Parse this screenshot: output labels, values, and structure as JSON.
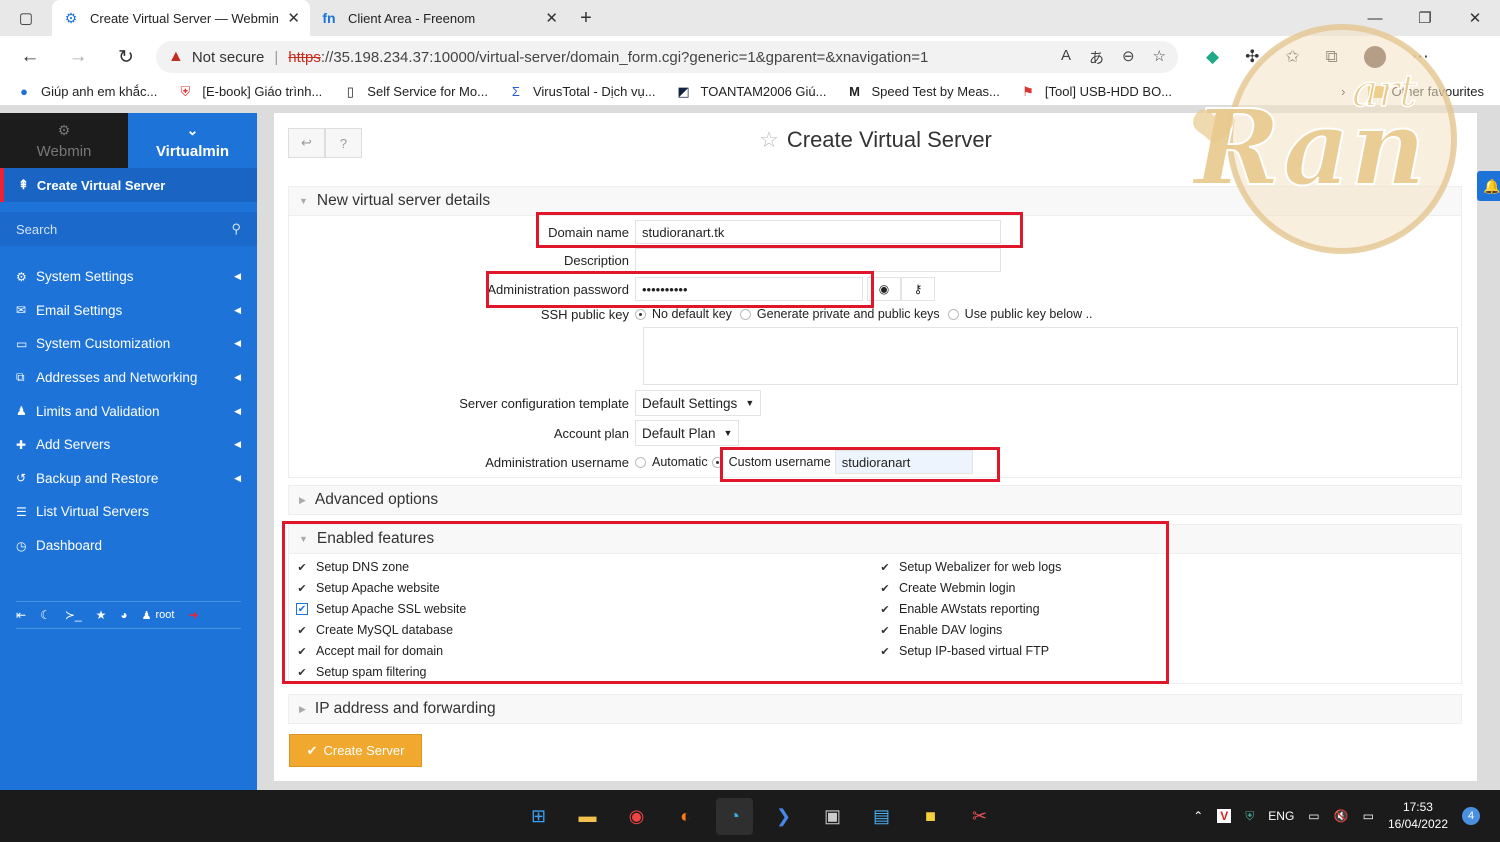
{
  "browser": {
    "tabs": [
      {
        "title": "Create Virtual Server — Webmin",
        "active": true
      },
      {
        "title": "Client Area - Freenom",
        "active": false
      }
    ],
    "address": {
      "security": "Not secure",
      "scheme": "https",
      "url_rest": "://35.198.234.37:10000/virtual-server/domain_form.cgi?generic=1&gparent=&xnavigation=1"
    },
    "bookmarks": [
      "Giúp anh em khắc...",
      "[E-book] Giáo trình...",
      "Self Service for Mo...",
      "VirusTotal - Dịch vụ...",
      "TOANTAM2006 Giú...",
      "Speed Test by Meas...",
      "[Tool] USB-HDD BO..."
    ],
    "other_favourites": "Other favourites"
  },
  "sidebar": {
    "tab_webmin": "Webmin",
    "tab_virtualmin": "Virtualmin",
    "current": "Create Virtual Server",
    "search_placeholder": "Search",
    "items": [
      {
        "label": "System Settings",
        "icon": "gear-icon"
      },
      {
        "label": "Email Settings",
        "icon": "envelope-icon"
      },
      {
        "label": "System Customization",
        "icon": "monitor-icon"
      },
      {
        "label": "Addresses and Networking",
        "icon": "network-icon"
      },
      {
        "label": "Limits and Validation",
        "icon": "user-icon"
      },
      {
        "label": "Add Servers",
        "icon": "plus-icon"
      },
      {
        "label": "Backup and Restore",
        "icon": "history-icon"
      },
      {
        "label": "List Virtual Servers",
        "icon": "list-icon"
      },
      {
        "label": "Dashboard",
        "icon": "dashboard-icon"
      }
    ],
    "user": "root"
  },
  "page": {
    "title": "Create Virtual Server",
    "details_section": "New virtual server details",
    "fields": {
      "domain_label": "Domain name",
      "domain_value": "studioranart.tk",
      "description_label": "Description",
      "description_value": "",
      "password_label": "Administration password",
      "password_value": "••••••••••",
      "ssh_label": "SSH public key",
      "ssh_options": [
        "No default key",
        "Generate private and public keys",
        "Use public key below .."
      ],
      "template_label": "Server configuration template",
      "template_value": "Default Settings",
      "plan_label": "Account plan",
      "plan_value": "Default Plan",
      "username_label": "Administration username",
      "username_opt_auto": "Automatic",
      "username_opt_custom": "Custom username",
      "username_value": "studioranart"
    },
    "advanced_section": "Advanced options",
    "features_section": "Enabled features",
    "features_left": [
      "Setup DNS zone",
      "Setup Apache website",
      "Setup Apache SSL website",
      "Create MySQL database",
      "Accept mail for domain",
      "Setup spam filtering"
    ],
    "features_right": [
      "Setup Webalizer for web logs",
      "Create Webmin login",
      "Enable AWstats reporting",
      "Enable DAV logins",
      "Setup IP-based virtual FTP"
    ],
    "ip_section": "IP address and forwarding",
    "create_button": "Create Server"
  },
  "taskbar": {
    "lang": "ENG",
    "time": "17:53",
    "date": "16/04/2022",
    "notifications": "4"
  },
  "watermark": {
    "text_small": "art",
    "text_big": "Ran"
  },
  "colors": {
    "accent": "#1e73d9",
    "highlight": "#e0172b",
    "button": "#f0a92e"
  }
}
